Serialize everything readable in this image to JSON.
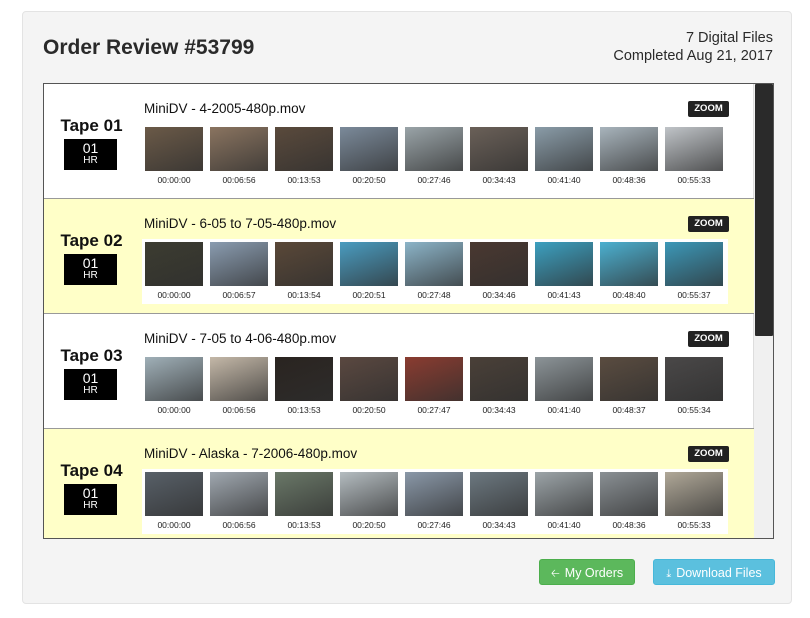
{
  "order": {
    "title": "Order Review #53799",
    "file_count": "7 Digital Files",
    "completed": "Completed Aug 21, 2017"
  },
  "tapes": [
    {
      "name": "Tape 01",
      "hours": "01",
      "hr_label": "HR",
      "file": "MiniDV - 4-2005-480p.mov",
      "zoom": "ZOOM",
      "timecodes": [
        "00:00:00",
        "00:06:56",
        "00:13:53",
        "00:20:50",
        "00:27:46",
        "00:34:43",
        "00:41:40",
        "00:48:36",
        "00:55:33"
      ]
    },
    {
      "name": "Tape 02",
      "hours": "01",
      "hr_label": "HR",
      "file": "MiniDV - 6-05 to 7-05-480p.mov",
      "zoom": "ZOOM",
      "timecodes": [
        "00:00:00",
        "00:06:57",
        "00:13:54",
        "00:20:51",
        "00:27:48",
        "00:34:46",
        "00:41:43",
        "00:48:40",
        "00:55:37"
      ]
    },
    {
      "name": "Tape 03",
      "hours": "01",
      "hr_label": "HR",
      "file": "MiniDV - 7-05 to 4-06-480p.mov",
      "zoom": "ZOOM",
      "timecodes": [
        "00:00:00",
        "00:06:56",
        "00:13:53",
        "00:20:50",
        "00:27:47",
        "00:34:43",
        "00:41:40",
        "00:48:37",
        "00:55:34"
      ]
    },
    {
      "name": "Tape 04",
      "hours": "01",
      "hr_label": "HR",
      "file": "MiniDV - Alaska - 7-2006-480p.mov",
      "zoom": "ZOOM",
      "timecodes": [
        "00:00:00",
        "00:06:56",
        "00:13:53",
        "00:20:50",
        "00:27:46",
        "00:34:43",
        "00:41:40",
        "00:48:36",
        "00:55:33"
      ]
    }
  ],
  "thumb_colors": [
    [
      "#6b5a48",
      "#8a7460",
      "#5a4a3c",
      "#7b8a9a",
      "#9aa4a8",
      "#6a6058",
      "#8a9ca8",
      "#a8b4bc",
      "#c0c4c8"
    ],
    [
      "#3c3c30",
      "#8a9cb0",
      "#5a4838",
      "#4a9cc0",
      "#8cb4c8",
      "#4a3830",
      "#3ca0c0",
      "#4cb0d0",
      "#3c98b8"
    ],
    [
      "#a0b0b8",
      "#c4b8a8",
      "#2a2420",
      "#5a4840",
      "#8a3c30",
      "#4a4038",
      "#8c9498",
      "#5a4c40",
      "#4a4848"
    ],
    [
      "#586068",
      "#a0a8b0",
      "#6a7868",
      "#b4bcc0",
      "#8a98a8",
      "#6c7880",
      "#9ca4a8",
      "#8a9094",
      "#b0a898"
    ]
  ],
  "buttons": {
    "my_orders": "My Orders",
    "download": "Download Files"
  },
  "icons": {
    "my_orders": "arrow-left-icon",
    "download": "download-icon"
  }
}
